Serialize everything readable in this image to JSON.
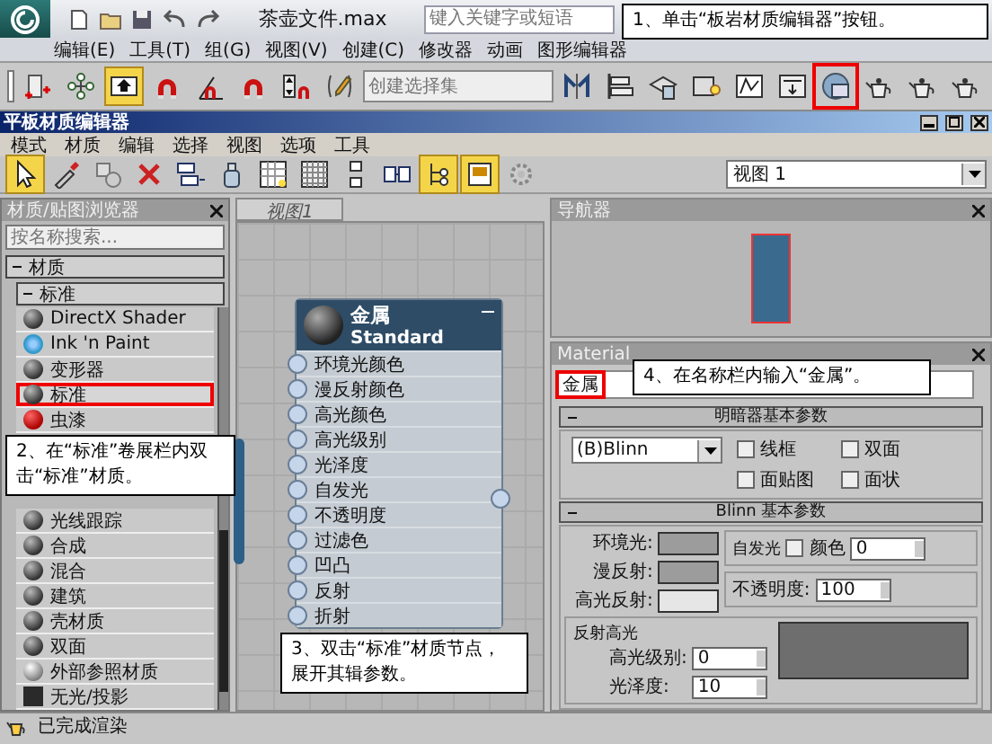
{
  "app": {
    "title": "茶壶文件.max",
    "search_placeholder": "键入关键字或短语"
  },
  "menu": [
    "编辑(E)",
    "工具(T)",
    "组(G)",
    "视图(V)",
    "创建(C)",
    "修改器",
    "动画",
    "图形编辑器"
  ],
  "toolbar": {
    "selection_set_placeholder": "创建选择集",
    "buttons": [
      {
        "kind": "link",
        "active": false,
        "highlighted": false
      },
      {
        "kind": "hierarchy",
        "active": false,
        "highlighted": false
      },
      {
        "kind": "move-up",
        "active": true,
        "highlighted": false
      },
      {
        "kind": "magnet",
        "active": false,
        "highlighted": false
      },
      {
        "kind": "angle",
        "active": false,
        "highlighted": false
      },
      {
        "kind": "magnet",
        "active": false,
        "highlighted": false
      },
      {
        "kind": "spinner",
        "active": false,
        "highlighted": false
      },
      {
        "kind": "pencil",
        "active": false,
        "highlighted": false
      },
      {
        "kind": "mirror",
        "active": false,
        "highlighted": false
      },
      {
        "kind": "align",
        "active": false,
        "highlighted": false
      },
      {
        "kind": "layers",
        "active": false,
        "highlighted": false
      },
      {
        "kind": "schematic",
        "active": false,
        "highlighted": false
      },
      {
        "kind": "curve",
        "active": false,
        "highlighted": false
      },
      {
        "kind": "frame",
        "active": false,
        "highlighted": false
      },
      {
        "kind": "slate",
        "active": false,
        "highlighted": true
      },
      {
        "kind": "teapot",
        "active": false,
        "highlighted": false
      },
      {
        "kind": "teapot",
        "active": false,
        "highlighted": false
      },
      {
        "kind": "teapot",
        "active": false,
        "highlighted": false
      }
    ]
  },
  "editor": {
    "title": "平板材质编辑器",
    "menu": [
      "模式",
      "材质",
      "编辑",
      "选择",
      "视图",
      "选项",
      "工具"
    ],
    "view_select": "视图 1",
    "buttons": [
      {
        "kind": "cursor",
        "active": true
      },
      {
        "kind": "eyedropper",
        "active": false
      },
      {
        "kind": "pick",
        "active": false
      },
      {
        "kind": "delete",
        "active": false
      },
      {
        "kind": "children",
        "active": false
      },
      {
        "kind": "put",
        "active": false
      },
      {
        "kind": "checker",
        "active": false
      },
      {
        "kind": "grid",
        "active": false
      },
      {
        "kind": "layout",
        "active": false
      },
      {
        "kind": "nodes",
        "active": false
      },
      {
        "kind": "tree",
        "active": true
      },
      {
        "kind": "preview",
        "active": true
      },
      {
        "kind": "gear",
        "active": false
      }
    ]
  },
  "browser": {
    "title": "材质/贴图浏览器",
    "search_placeholder": "按名称搜索...",
    "group": {
      "label": "材质",
      "expanded": true
    },
    "subgroup": {
      "label": "标准",
      "expanded": true
    },
    "items": [
      {
        "label": "DirectX Shader",
        "kind": "sphere",
        "highlighted": false
      },
      {
        "label": "Ink 'n Paint",
        "kind": "globe",
        "highlighted": false
      },
      {
        "label": "变形器",
        "kind": "sphere",
        "highlighted": false
      },
      {
        "label": "标准",
        "kind": "sphere",
        "highlighted": true
      },
      {
        "label": "虫漆",
        "kind": "red",
        "highlighted": false
      },
      {
        "label": "光线跟踪",
        "kind": "sphere",
        "highlighted": false
      },
      {
        "label": "合成",
        "kind": "sphere",
        "highlighted": false
      },
      {
        "label": "混合",
        "kind": "sphere",
        "highlighted": false
      },
      {
        "label": "建筑",
        "kind": "sphere",
        "highlighted": false
      },
      {
        "label": "壳材质",
        "kind": "sphere",
        "highlighted": false
      },
      {
        "label": "双面",
        "kind": "sphere",
        "highlighted": false
      },
      {
        "label": "外部参照材质",
        "kind": "chrome",
        "highlighted": false
      },
      {
        "label": "无光/投影",
        "kind": "dark",
        "highlighted": false
      }
    ]
  },
  "view_tab": "视图1",
  "node": {
    "title": "金属",
    "subtitle": "Standard",
    "slots": [
      "环境光颜色",
      "漫反射颜色",
      "高光颜色",
      "高光级别",
      "光泽度",
      "自发光",
      "不透明度",
      "过滤色",
      "凹凸",
      "反射",
      "折射"
    ]
  },
  "navigator": {
    "title": "导航器"
  },
  "material_panel": {
    "title": "Material",
    "name": "金属",
    "name_highlighted": true,
    "shader_rollout": {
      "title": "明暗器基本参数",
      "shader": "(B)Blinn",
      "options": [
        {
          "label": "线框",
          "checked": false
        },
        {
          "label": "双面",
          "checked": false
        },
        {
          "label": "面贴图",
          "checked": false
        },
        {
          "label": "面状",
          "checked": false
        }
      ]
    },
    "blinn_rollout": {
      "title": "Blinn 基本参数",
      "colors": [
        {
          "label": "环境光:",
          "color": "#9c9c9c"
        },
        {
          "label": "漫反射:",
          "color": "#9c9c9c"
        },
        {
          "label": "高光反射:",
          "color": "#e6e6e6"
        }
      ],
      "self_illum": {
        "title": "自发光",
        "label": "颜色",
        "checked": false,
        "value": "0"
      },
      "opacity": {
        "label": "不透明度:",
        "value": "100"
      },
      "specular": {
        "title": "反射高光",
        "fields": [
          {
            "label": "高光级别:",
            "value": "0"
          },
          {
            "label": "光泽度:",
            "value": "10"
          }
        ]
      }
    }
  },
  "status": "已完成渲染",
  "callouts": [
    {
      "text": "1、单击“板岩材质编辑器”按钮。"
    },
    {
      "text": "2、在“标准”卷展栏内双击“标准”材质。"
    },
    {
      "text": "3、双击“标准”材质节点，展开其辑参数。"
    },
    {
      "text": "4、在名称栏内输入“金属”。"
    }
  ]
}
